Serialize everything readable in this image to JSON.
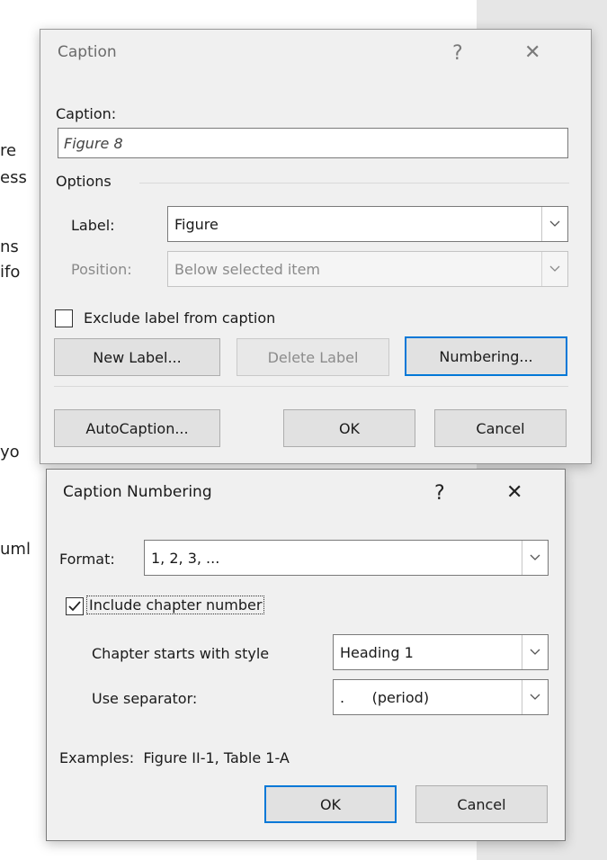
{
  "background_fragments": [
    "re",
    "ess",
    "ns",
    "ifo",
    "yo",
    "uml"
  ],
  "caption_dialog": {
    "title": "Caption",
    "help_symbol": "?",
    "close_symbol": "✕",
    "caption_label": "Caption:",
    "caption_value": "Figure 8",
    "options_label": "Options",
    "label_label": "Label:",
    "label_value": "Figure",
    "position_label": "Position:",
    "position_value": "Below selected item",
    "exclude_label": "Exclude label from caption",
    "new_label_button": "New Label...",
    "delete_label_button": "Delete Label",
    "numbering_button": "Numbering...",
    "autocaption_button": "AutoCaption...",
    "ok_button": "OK",
    "cancel_button": "Cancel"
  },
  "numbering_dialog": {
    "title": "Caption Numbering",
    "help_symbol": "?",
    "close_symbol": "✕",
    "format_label": "Format:",
    "format_value": "1, 2, 3, ...",
    "include_chapter_label": "Include chapter number",
    "include_chapter_checked": true,
    "chapter_style_label": "Chapter starts with style",
    "chapter_style_value": "Heading 1",
    "separator_label": "Use separator:",
    "separator_value": ".      (period)",
    "examples_text": "Examples:  Figure II-1, Table 1-A",
    "ok_button": "OK",
    "cancel_button": "Cancel"
  }
}
